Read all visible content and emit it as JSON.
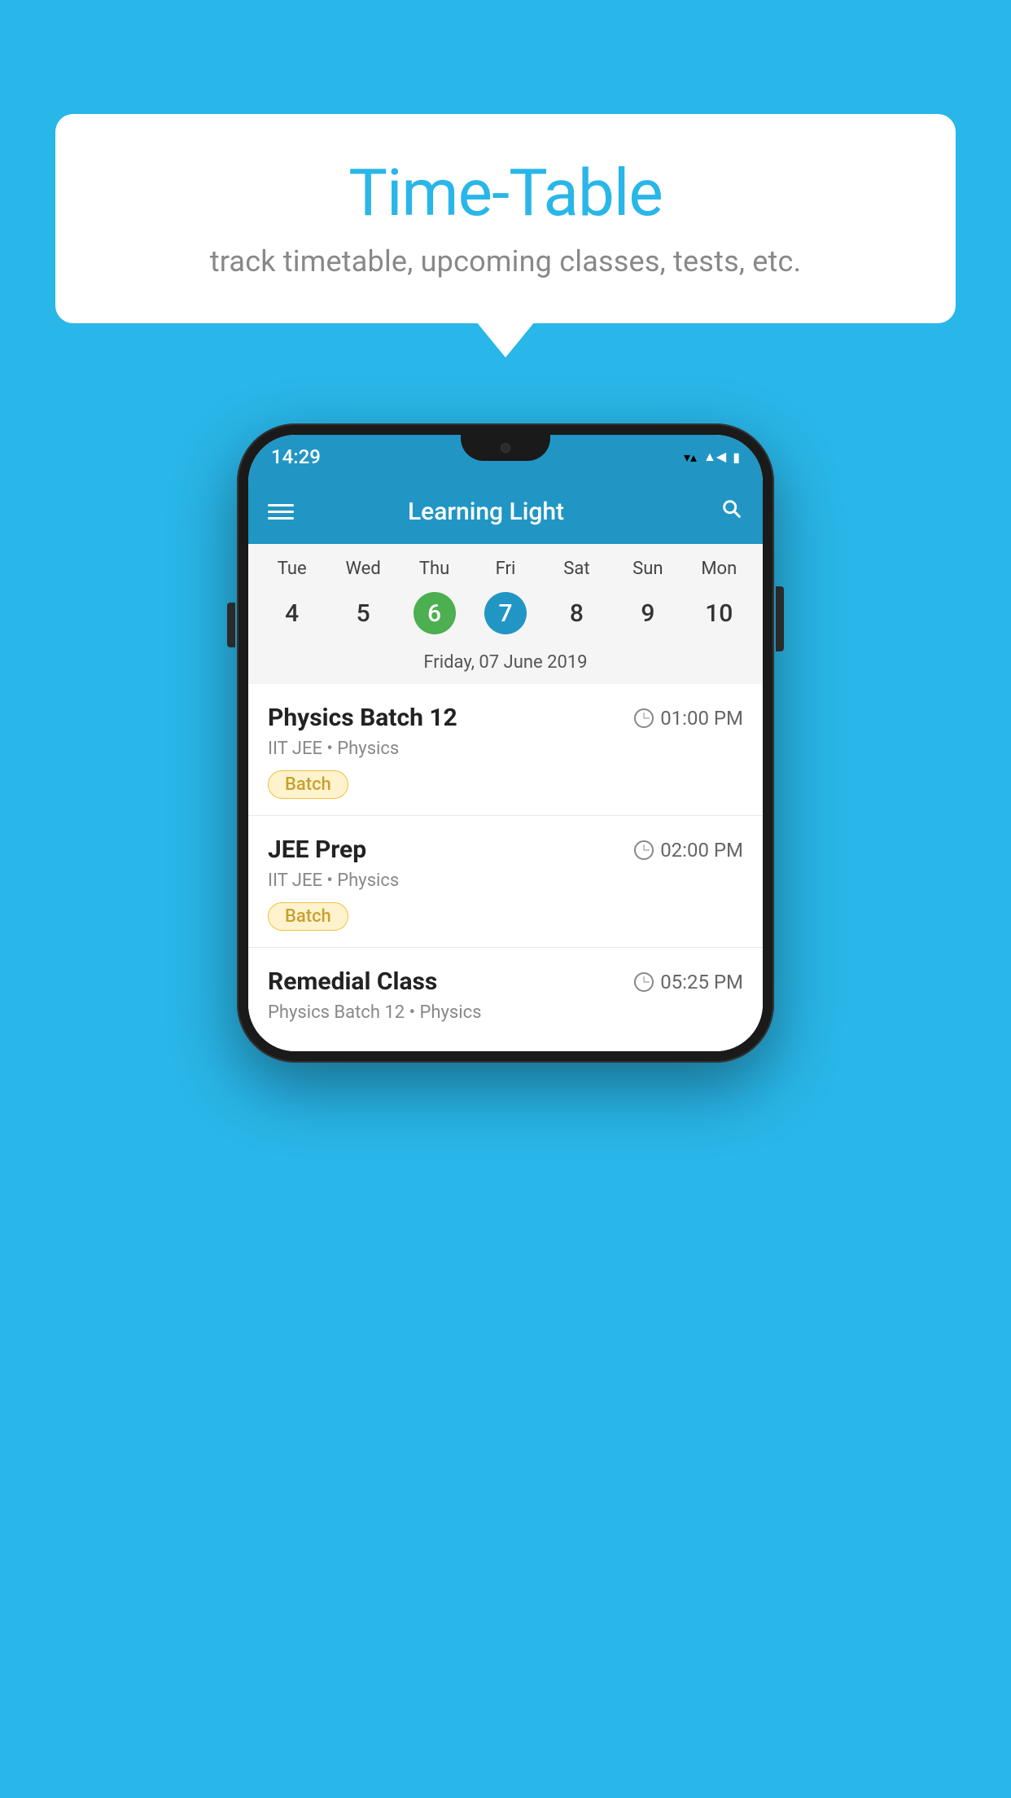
{
  "page": {
    "background_color": "#29B6E8"
  },
  "speech_bubble": {
    "title": "Time-Table",
    "subtitle": "track timetable, upcoming classes, tests, etc."
  },
  "app": {
    "title": "Learning Light",
    "time": "14:29"
  },
  "calendar": {
    "selected_date_label": "Friday, 07 June 2019",
    "days": [
      "Tue",
      "Wed",
      "Thu",
      "Fri",
      "Sat",
      "Sun",
      "Mon"
    ],
    "dates": [
      {
        "num": "4",
        "state": "normal"
      },
      {
        "num": "5",
        "state": "normal"
      },
      {
        "num": "6",
        "state": "today"
      },
      {
        "num": "7",
        "state": "selected"
      },
      {
        "num": "8",
        "state": "normal"
      },
      {
        "num": "9",
        "state": "normal"
      },
      {
        "num": "10",
        "state": "normal"
      }
    ]
  },
  "schedule": {
    "items": [
      {
        "name": "Physics Batch 12",
        "time": "01:00 PM",
        "meta": "IIT JEE • Physics",
        "badge": "Batch"
      },
      {
        "name": "JEE Prep",
        "time": "02:00 PM",
        "meta": "IIT JEE • Physics",
        "badge": "Batch"
      },
      {
        "name": "Remedial Class",
        "time": "05:25 PM",
        "meta": "Physics Batch 12 • Physics",
        "badge": ""
      }
    ]
  },
  "icons": {
    "menu": "☰",
    "search": "🔍"
  }
}
